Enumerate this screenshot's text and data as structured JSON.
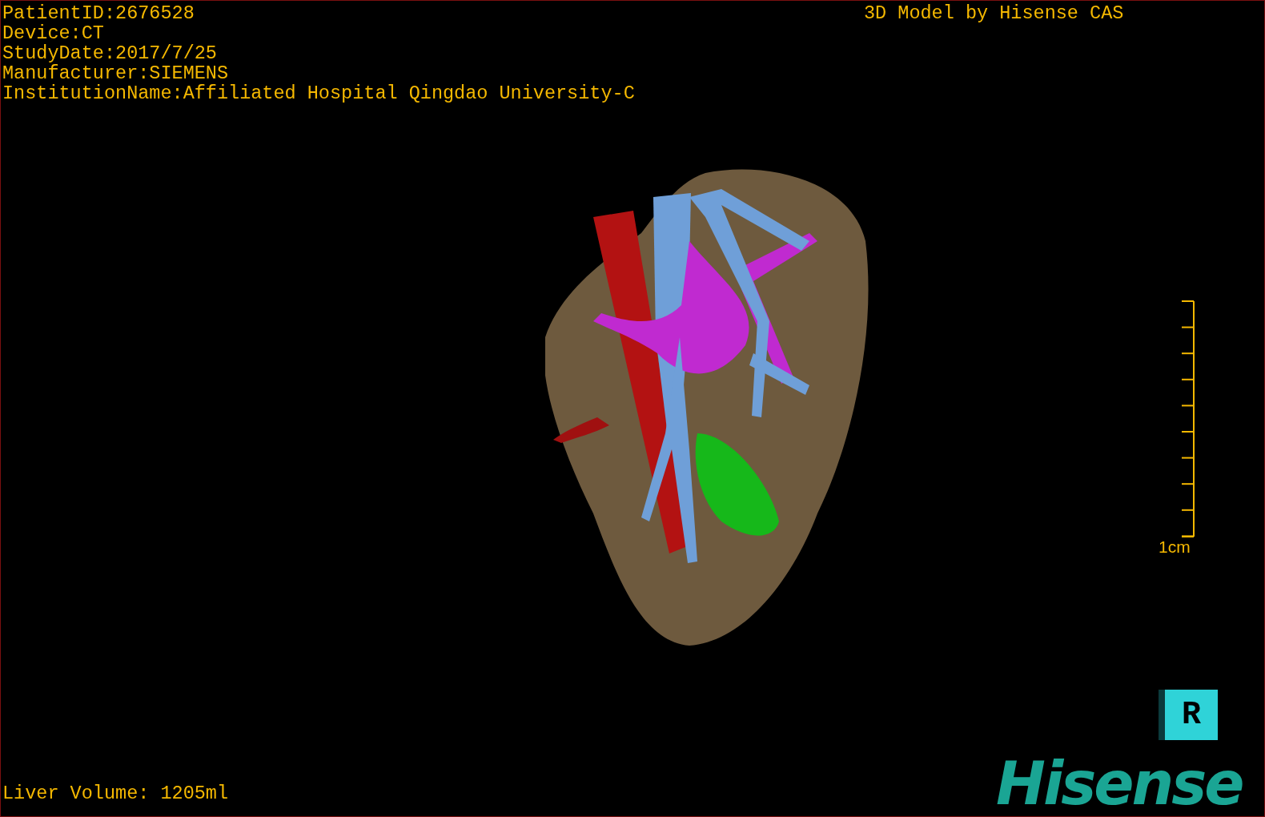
{
  "patient_info": [
    "PatientID:2676528",
    "Device:CT",
    "StudyDate:2017/7/25",
    "Manufacturer:SIEMENS",
    "InstitutionName:Affiliated Hospital Qingdao University-C"
  ],
  "model_credit": "3D Model by Hisense CAS",
  "scale_bar": {
    "label": "1cm"
  },
  "orientation_marker": {
    "label": "R"
  },
  "liver_volume": "Liver Volume: 1205ml",
  "logo": "Hisense"
}
